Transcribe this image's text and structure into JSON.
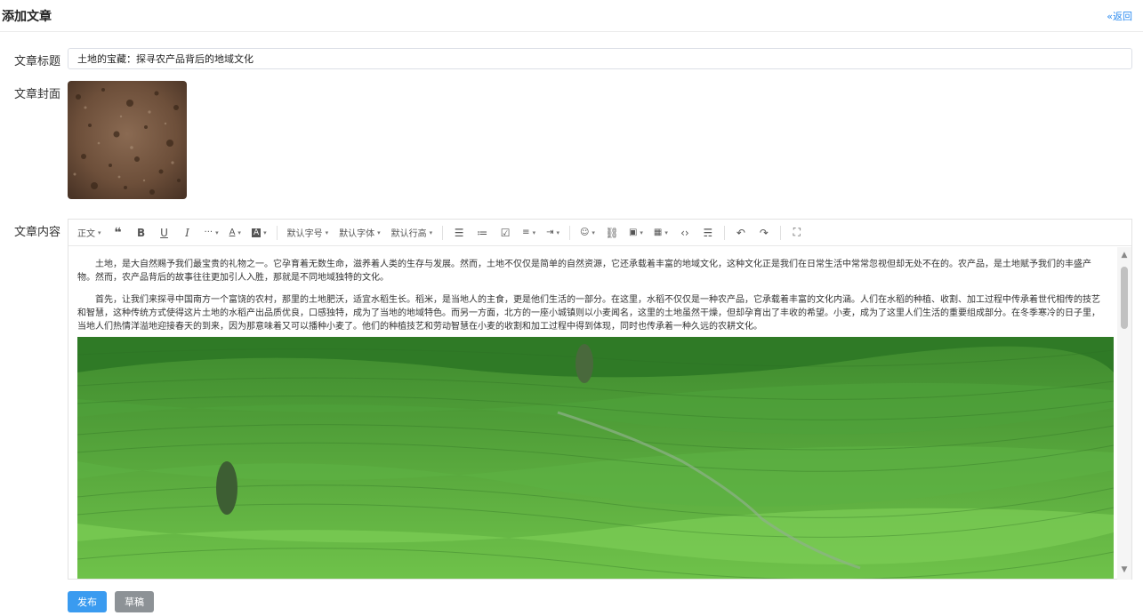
{
  "header": {
    "title": "添加文章",
    "back_label": "«返回"
  },
  "form": {
    "title_label": "文章标题",
    "title_value": "土地的宝藏：探寻农产品背后的地域文化",
    "cover_label": "文章封面",
    "content_label": "文章内容"
  },
  "toolbar": {
    "paragraph_style": "正文",
    "font_size": "默认字号",
    "font_family": "默认字体",
    "line_height": "默认行高",
    "icons": [
      "quote-icon",
      "bold-icon",
      "underline-icon",
      "italic-icon",
      "more-icon",
      "font-color-icon",
      "background-color-icon",
      "bulleted-list-icon",
      "numbered-list-icon",
      "todo-icon",
      "align-icon",
      "indent-icon",
      "emoji-icon",
      "link-icon",
      "image-icon",
      "table-icon",
      "code-icon",
      "divider-icon",
      "undo-icon",
      "redo-icon",
      "fullscreen-icon"
    ]
  },
  "content": {
    "paragraphs": [
      "土地，是大自然赐予我们最宝贵的礼物之一。它孕育着无数生命，滋养着人类的生存与发展。然而，土地不仅仅是简单的自然资源，它还承载着丰富的地域文化，这种文化正是我们在日常生活中常常忽视但却无处不在的。农产品，是土地赋予我们的丰盛产物。然而，农产品背后的故事往往更加引人入胜，那就是不同地域独特的文化。",
      "首先，让我们来探寻中国南方一个富饶的农村，那里的土地肥沃，适宜水稻生长。稻米，是当地人的主食，更是他们生活的一部分。在这里，水稻不仅仅是一种农产品，它承载着丰富的文化内涵。人们在水稻的种植、收割、加工过程中传承着世代相传的技艺和智慧，这种传统方式使得这片土地的水稻产出品质优良，口感独特，成为了当地的地域特色。而另一方面，北方的一座小城镇则以小麦闻名，这里的土地虽然干燥，但却孕育出了丰收的希望。小麦，成为了这里人们生活的重要组成部分。在冬季寒冷的日子里，当地人们热情洋溢地迎接春天的到来，因为那意味着又可以播种小麦了。他们的种植技艺和劳动智慧在小麦的收割和加工过程中得到体现，同时也传承着一种久远的农耕文化。"
    ]
  },
  "actions": {
    "publish_label": "发布",
    "draft_label": "草稿"
  },
  "colors": {
    "primary": "#3a9bf0",
    "secondary": "#8d9296",
    "link": "#2d8cf0"
  }
}
